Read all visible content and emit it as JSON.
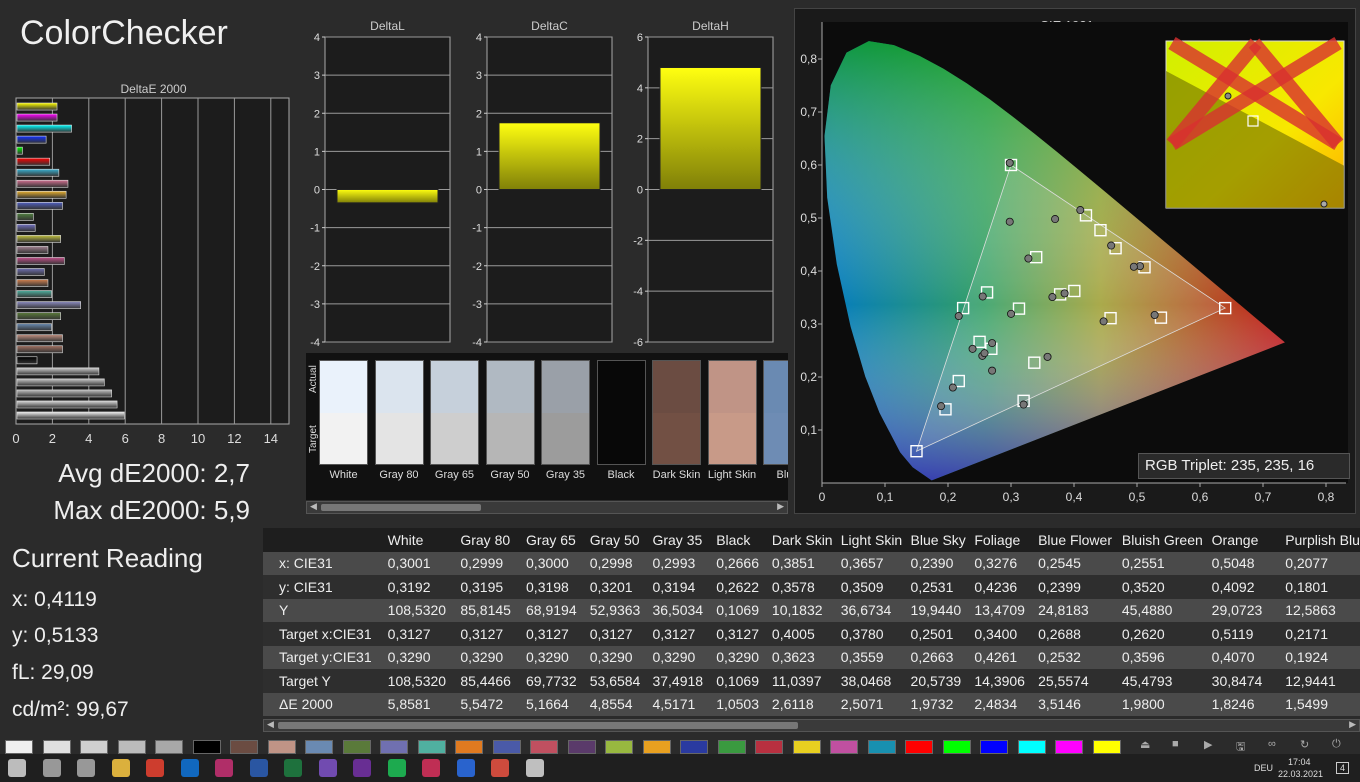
{
  "app_title": "ColorChecker",
  "summary": {
    "avg": "Avg dE2000: 2,7",
    "max": "Max dE2000: 5,9"
  },
  "current_reading": {
    "title": "Current Reading",
    "x": "x: 0,4119",
    "y": "y: 0,5133",
    "fL": "fL: 29,09",
    "cdm2": "cd/m²: 99,67"
  },
  "rgb_triplet": "RGB Triplet: 235, 235, 16",
  "chart_data": [
    {
      "type": "bar",
      "orientation": "horizontal",
      "title": "DeltaE 2000",
      "xlim": [
        0,
        15
      ],
      "xticks": [
        0,
        2,
        4,
        6,
        8,
        10,
        12,
        14
      ],
      "values": [
        2.2,
        2.2,
        3.0,
        1.6,
        0.3,
        1.8,
        2.3,
        2.8,
        2.7,
        2.5,
        0.9,
        1.0,
        2.4,
        1.7,
        2.6,
        1.5,
        1.7,
        1.9,
        3.5,
        2.4,
        1.9,
        2.5,
        2.5,
        1.1,
        4.5,
        4.8,
        5.2,
        5.5,
        5.9
      ],
      "colors": [
        "#ffff00",
        "#ff00ff",
        "#00ffff",
        "#1030ff",
        "#00ff00",
        "#ff0000",
        "#3ab0d0",
        "#d07090",
        "#e8b030",
        "#5060c0",
        "#508040",
        "#7070c0",
        "#c0c040",
        "#a08090",
        "#c0508a",
        "#6f6fb0",
        "#d08050",
        "#50b0a0",
        "#8c8cc0",
        "#5a7a3a",
        "#6a8ab0",
        "#c09080",
        "#a07060",
        "#000000",
        "#d0d0d0",
        "#c8c8c8",
        "#c0c0c0",
        "#d8d8d8",
        "#f0f0f0"
      ]
    },
    {
      "type": "bar",
      "title": "DeltaL",
      "ylim": [
        -4,
        4
      ],
      "yticks": [
        4,
        3,
        2,
        1,
        0,
        -1,
        -2,
        -3,
        -4
      ],
      "values": [
        -0.35
      ]
    },
    {
      "type": "bar",
      "title": "DeltaC",
      "ylim": [
        -4,
        4
      ],
      "yticks": [
        4,
        3,
        2,
        1,
        0,
        -1,
        -2,
        -3,
        -4
      ],
      "values": [
        1.75
      ]
    },
    {
      "type": "bar",
      "title": "DeltaH",
      "ylim": [
        -6,
        6
      ],
      "yticks": [
        6,
        4,
        2,
        0,
        -2,
        -4,
        -6
      ],
      "values": [
        4.8
      ]
    },
    {
      "type": "scatter",
      "title": "CIE 1931 xy",
      "xlim": [
        0,
        0.8
      ],
      "ylim": [
        0,
        0.8
      ],
      "xticks": [
        "0",
        "0,1",
        "0,2",
        "0,3",
        "0,4",
        "0,5",
        "0,6",
        "0,7",
        "0,8"
      ],
      "yticks": [
        "0,1",
        "0,2",
        "0,3",
        "0,4",
        "0,5",
        "0,6",
        "0,7",
        "0,8"
      ],
      "gamut": [
        [
          0.64,
          0.33
        ],
        [
          0.3,
          0.6
        ],
        [
          0.15,
          0.06
        ]
      ],
      "targets": [
        [
          0.3127,
          0.329
        ],
        [
          0.4005,
          0.3623
        ],
        [
          0.378,
          0.3559
        ],
        [
          0.2501,
          0.2663
        ],
        [
          0.34,
          0.4261
        ],
        [
          0.2688,
          0.2532
        ],
        [
          0.262,
          0.3596
        ],
        [
          0.5119,
          0.407
        ],
        [
          0.2171,
          0.1924
        ],
        [
          0.458,
          0.311
        ],
        [
          0.337,
          0.227
        ],
        [
          0.419,
          0.505
        ],
        [
          0.466,
          0.443
        ],
        [
          0.196,
          0.139
        ],
        [
          0.3,
          0.6
        ],
        [
          0.538,
          0.312
        ],
        [
          0.442,
          0.477
        ],
        [
          0.32,
          0.155
        ],
        [
          0.224,
          0.33
        ],
        [
          0.15,
          0.06
        ],
        [
          0.64,
          0.33
        ]
      ],
      "measured": [
        [
          0.3001,
          0.3192
        ],
        [
          0.3851,
          0.3578
        ],
        [
          0.3657,
          0.3509
        ],
        [
          0.239,
          0.2531
        ],
        [
          0.3276,
          0.4236
        ],
        [
          0.2545,
          0.2399
        ],
        [
          0.2551,
          0.352
        ],
        [
          0.5048,
          0.4092
        ],
        [
          0.2077,
          0.1801
        ],
        [
          0.447,
          0.305
        ],
        [
          0.358,
          0.238
        ],
        [
          0.41,
          0.515
        ],
        [
          0.459,
          0.448
        ],
        [
          0.189,
          0.145
        ],
        [
          0.298,
          0.604
        ],
        [
          0.528,
          0.317
        ],
        [
          0.495,
          0.408
        ],
        [
          0.32,
          0.148
        ],
        [
          0.217,
          0.315
        ],
        [
          0.27,
          0.212
        ],
        [
          0.37,
          0.498
        ],
        [
          0.298,
          0.493
        ],
        [
          0.258,
          0.245
        ],
        [
          0.27,
          0.264
        ]
      ]
    }
  ],
  "swatch_strip": {
    "row_labels": {
      "actual": "Actual",
      "target": "Target"
    },
    "items": [
      {
        "name": "White",
        "actual": "#eaf2fb",
        "target": "#f2f2f2"
      },
      {
        "name": "Gray 80",
        "actual": "#dbe4ee",
        "target": "#e4e4e4"
      },
      {
        "name": "Gray 65",
        "actual": "#c6d0db",
        "target": "#cecece"
      },
      {
        "name": "Gray 50",
        "actual": "#b0b9c2",
        "target": "#b6b6b6"
      },
      {
        "name": "Gray 35",
        "actual": "#9aa0a8",
        "target": "#9c9c9c"
      },
      {
        "name": "Black",
        "actual": "#080808",
        "target": "#080808"
      },
      {
        "name": "Dark Skin",
        "actual": "#6b4c42",
        "target": "#725044"
      },
      {
        "name": "Light Skin",
        "actual": "#c09486",
        "target": "#c89a88"
      },
      {
        "name": "Blue",
        "actual": "#6a8ab2",
        "target": "#6e8cb4"
      }
    ]
  },
  "table": {
    "columns": [
      "White",
      "Gray 80",
      "Gray 65",
      "Gray 50",
      "Gray 35",
      "Black",
      "Dark Skin",
      "Light Skin",
      "Blue Sky",
      "Foliage",
      "Blue Flower",
      "Bluish Green",
      "Orange",
      "Purplish Blu"
    ],
    "rows": [
      {
        "label": "x: CIE31",
        "values": [
          "0,3001",
          "0,2999",
          "0,3000",
          "0,2998",
          "0,2993",
          "0,2666",
          "0,3851",
          "0,3657",
          "0,2390",
          "0,3276",
          "0,2545",
          "0,2551",
          "0,5048",
          "0,2077"
        ]
      },
      {
        "label": "y: CIE31",
        "values": [
          "0,3192",
          "0,3195",
          "0,3198",
          "0,3201",
          "0,3194",
          "0,2622",
          "0,3578",
          "0,3509",
          "0,2531",
          "0,4236",
          "0,2399",
          "0,3520",
          "0,4092",
          "0,1801"
        ]
      },
      {
        "label": "Y",
        "values": [
          "108,5320",
          "85,8145",
          "68,9194",
          "52,9363",
          "36,5034",
          "0,1069",
          "10,1832",
          "36,6734",
          "19,9440",
          "13,4709",
          "24,8183",
          "45,4880",
          "29,0723",
          "12,5863"
        ]
      },
      {
        "label": "Target x:CIE31",
        "values": [
          "0,3127",
          "0,3127",
          "0,3127",
          "0,3127",
          "0,3127",
          "0,3127",
          "0,4005",
          "0,3780",
          "0,2501",
          "0,3400",
          "0,2688",
          "0,2620",
          "0,5119",
          "0,2171"
        ]
      },
      {
        "label": "Target y:CIE31",
        "values": [
          "0,3290",
          "0,3290",
          "0,3290",
          "0,3290",
          "0,3290",
          "0,3290",
          "0,3623",
          "0,3559",
          "0,2663",
          "0,4261",
          "0,2532",
          "0,3596",
          "0,4070",
          "0,1924"
        ]
      },
      {
        "label": "Target Y",
        "values": [
          "108,5320",
          "85,4466",
          "69,7732",
          "53,6584",
          "37,4918",
          "0,1069",
          "11,0397",
          "38,0468",
          "20,5739",
          "14,3906",
          "25,5574",
          "45,4793",
          "30,8474",
          "12,9441"
        ]
      },
      {
        "label": "ΔE 2000",
        "values": [
          "5,8581",
          "5,5472",
          "5,1664",
          "4,8554",
          "4,5171",
          "1,0503",
          "2,6118",
          "2,5071",
          "1,9732",
          "2,4834",
          "3,5146",
          "1,9800",
          "1,8246",
          "1,5499"
        ]
      }
    ]
  },
  "bottom_swatches": [
    "#f0f0f0",
    "#e0e0e0",
    "#d0d0d0",
    "#bbbbbb",
    "#a8a8a8",
    "#000000",
    "#6b4c42",
    "#c09486",
    "#6a8ab2",
    "#5a7a3a",
    "#7070b0",
    "#50b0a0",
    "#e07a20",
    "#4a5aa8",
    "#c05060",
    "#5a3a6a",
    "#98b840",
    "#e8a020",
    "#2a3aa0",
    "#3a9a40",
    "#b83040",
    "#e8d020",
    "#c050a0",
    "#1890b0",
    "#ff0000",
    "#00ff00",
    "#0000ff",
    "#00ffff",
    "#ff00ff",
    "#ffff00"
  ],
  "taskbar": {
    "language": "DEU",
    "time": "17:04",
    "date": "22.03.2021",
    "notifications": "4",
    "app_icons": [
      "windows-icon",
      "search-icon",
      "task-view-icon",
      "file-explorer-icon",
      "chrome-icon",
      "outlook-icon",
      "slack-icon",
      "word-icon",
      "excel-icon",
      "affinity-icon",
      "onenote-icon",
      "spotify-icon",
      "indesign-icon",
      "onepassword-icon",
      "calman-icon",
      "colormunki-icon"
    ]
  }
}
